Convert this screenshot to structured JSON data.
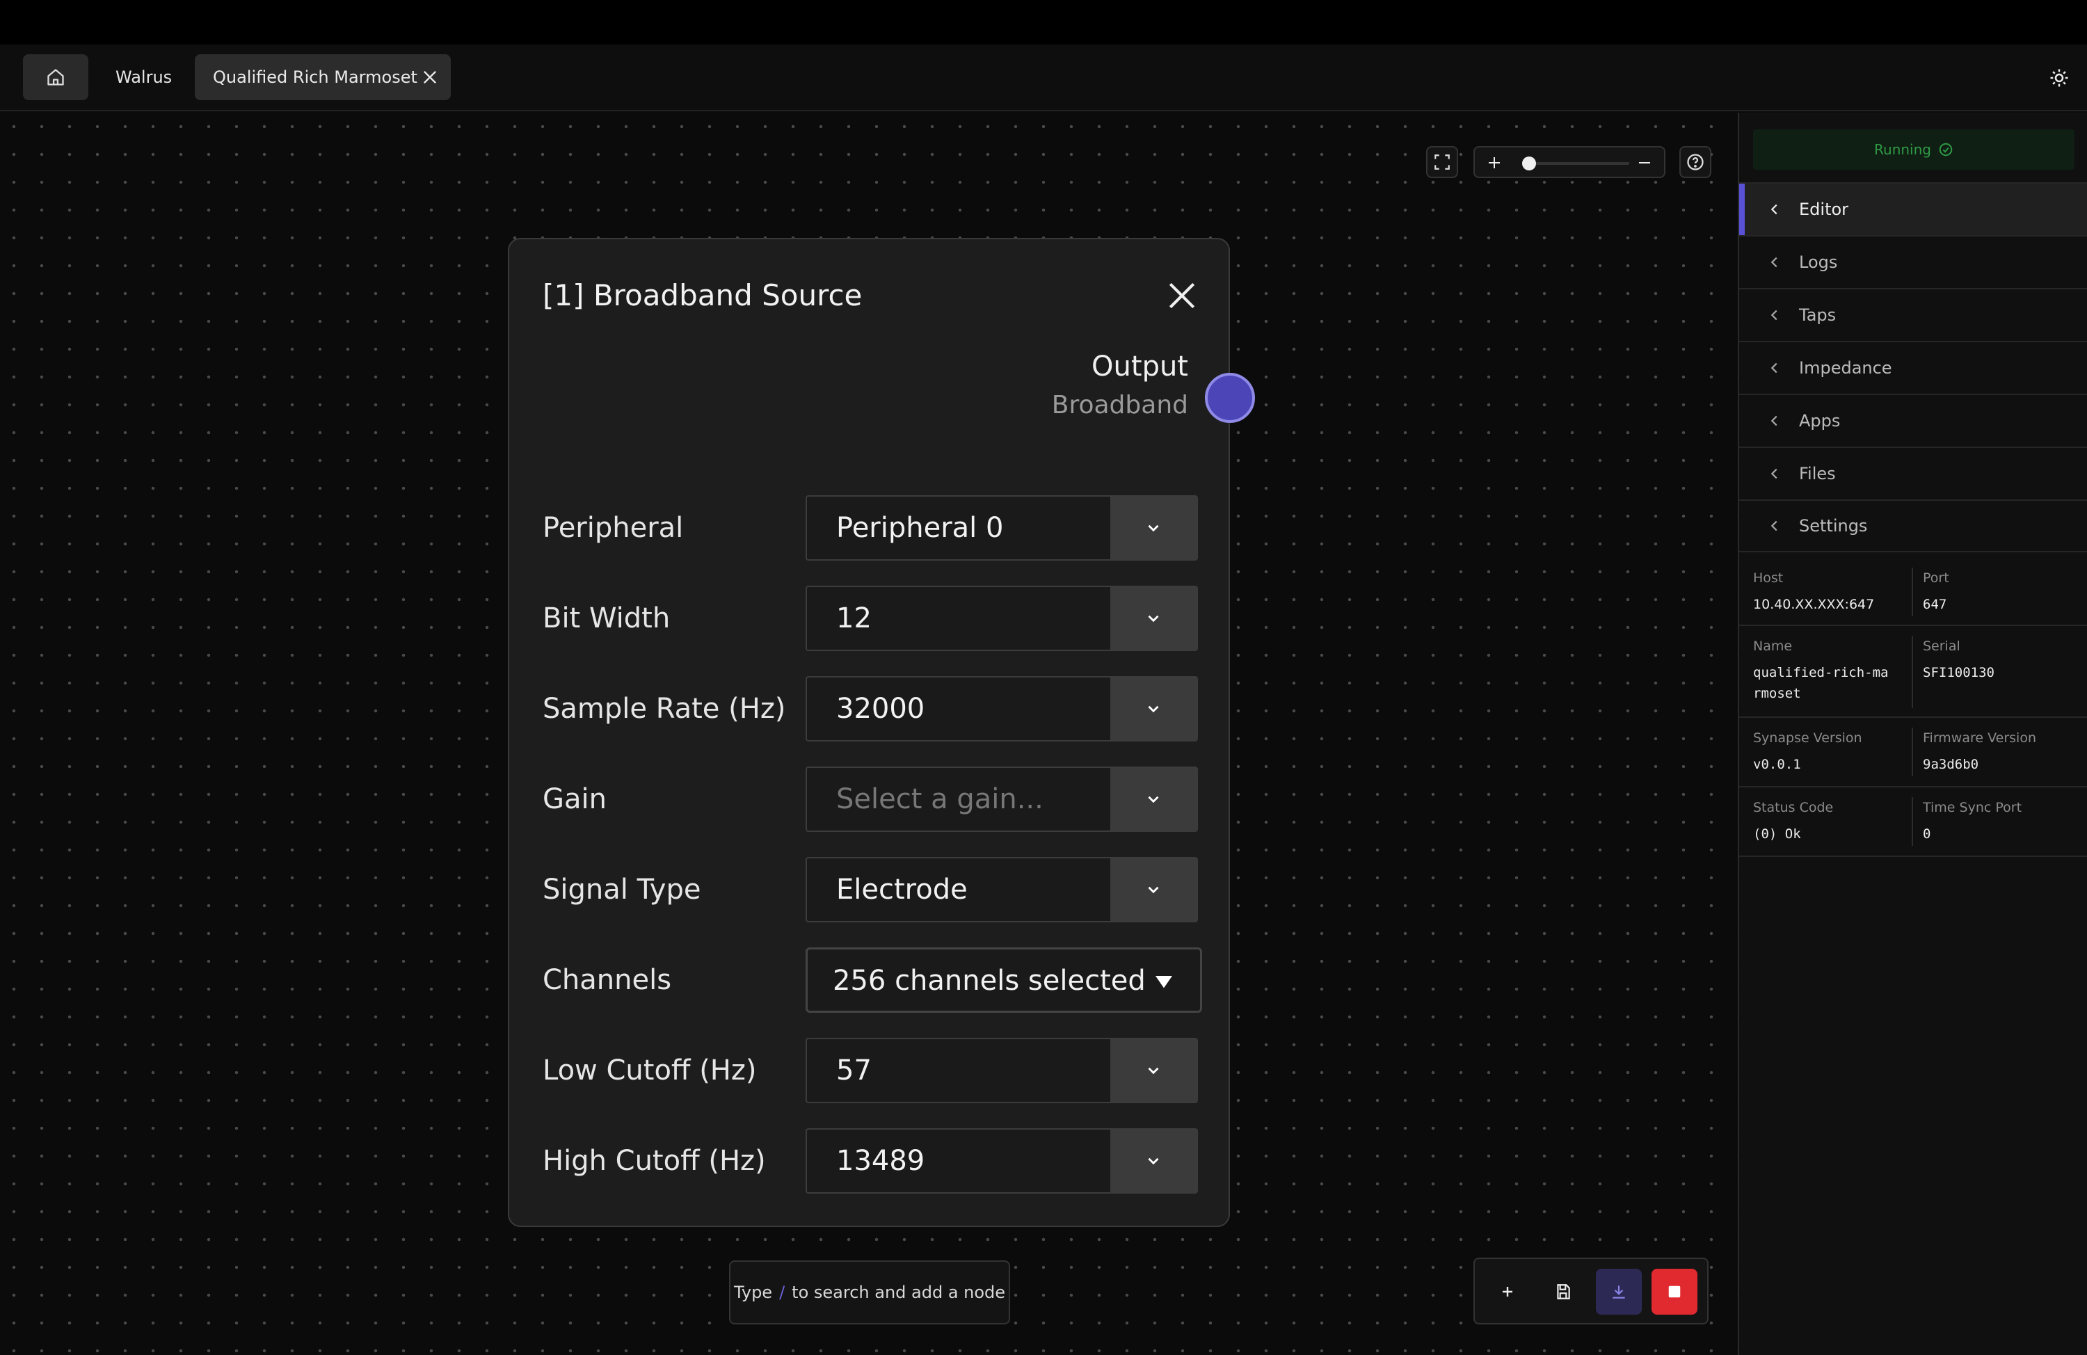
{
  "tabs": {
    "home_icon": "home-icon",
    "walrus_label": "Walrus",
    "active_label": "Qualified Rich Marmoset"
  },
  "node": {
    "title": "[1] Broadband Source",
    "output_label": "Output",
    "output_type": "Broadband",
    "port_color": "#4b45b8",
    "fields": [
      {
        "label": "Peripheral",
        "value": "Peripheral 0"
      },
      {
        "label": "Bit Width",
        "value": "12"
      },
      {
        "label": "Sample Rate (Hz)",
        "value": "32000"
      },
      {
        "label": "Gain",
        "placeholder": "Select a gain..."
      },
      {
        "label": "Signal Type",
        "value": "Electrode"
      },
      {
        "label": "Channels",
        "value": "256 channels selected"
      },
      {
        "label": "Low Cutoff (Hz)",
        "value": "57"
      },
      {
        "label": "High Cutoff (Hz)",
        "value": "13489"
      }
    ]
  },
  "search_hint": {
    "before": "Type",
    "key": "/",
    "after": "to search and add a node"
  },
  "panel": {
    "status": "Running",
    "status_color": "#2f9a45",
    "nav": [
      "Editor",
      "Logs",
      "Taps",
      "Impedance",
      "Apps",
      "Files",
      "Settings"
    ],
    "active_nav": "Editor",
    "info": [
      {
        "left_label": "Host",
        "left_value": "10.40.XX.XXX:647",
        "right_label": "Port",
        "right_value": "647"
      },
      {
        "left_label": "Name",
        "left_value": "qualified-rich-marmoset",
        "right_label": "Serial",
        "right_value": "SFI100130"
      },
      {
        "left_label": "Synapse Version",
        "left_value": "v0.0.1",
        "right_label": "Firmware Version",
        "right_value": "9a3d6b0"
      },
      {
        "left_label": "Status Code",
        "left_value": "(0) Ok",
        "right_label": "Time Sync Port",
        "right_value": "0"
      }
    ]
  },
  "colors": {
    "accent": "#5a52d6",
    "stop": "#e02a30",
    "deploy_bg": "#2c2a55"
  }
}
